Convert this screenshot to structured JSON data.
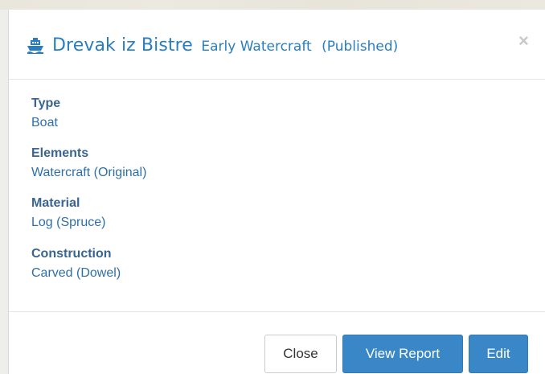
{
  "modal": {
    "title": "Drevak iz Bistre",
    "subtitle": "Early Watercraft",
    "status": "(Published)",
    "close_symbol": "×",
    "icon": "ship-icon"
  },
  "fields": [
    {
      "label": "Type",
      "value": "Boat"
    },
    {
      "label": "Elements",
      "value": "Watercraft (Original)"
    },
    {
      "label": "Material",
      "value": "Log (Spruce)"
    },
    {
      "label": "Construction",
      "value": "Carved (Dowel)"
    }
  ],
  "footer": {
    "close_label": "Close",
    "report_label": "View Report",
    "edit_label": "Edit"
  },
  "colors": {
    "accent": "#2a7ec0",
    "primary_button": "#3a87c8",
    "label": "#3a6590"
  }
}
